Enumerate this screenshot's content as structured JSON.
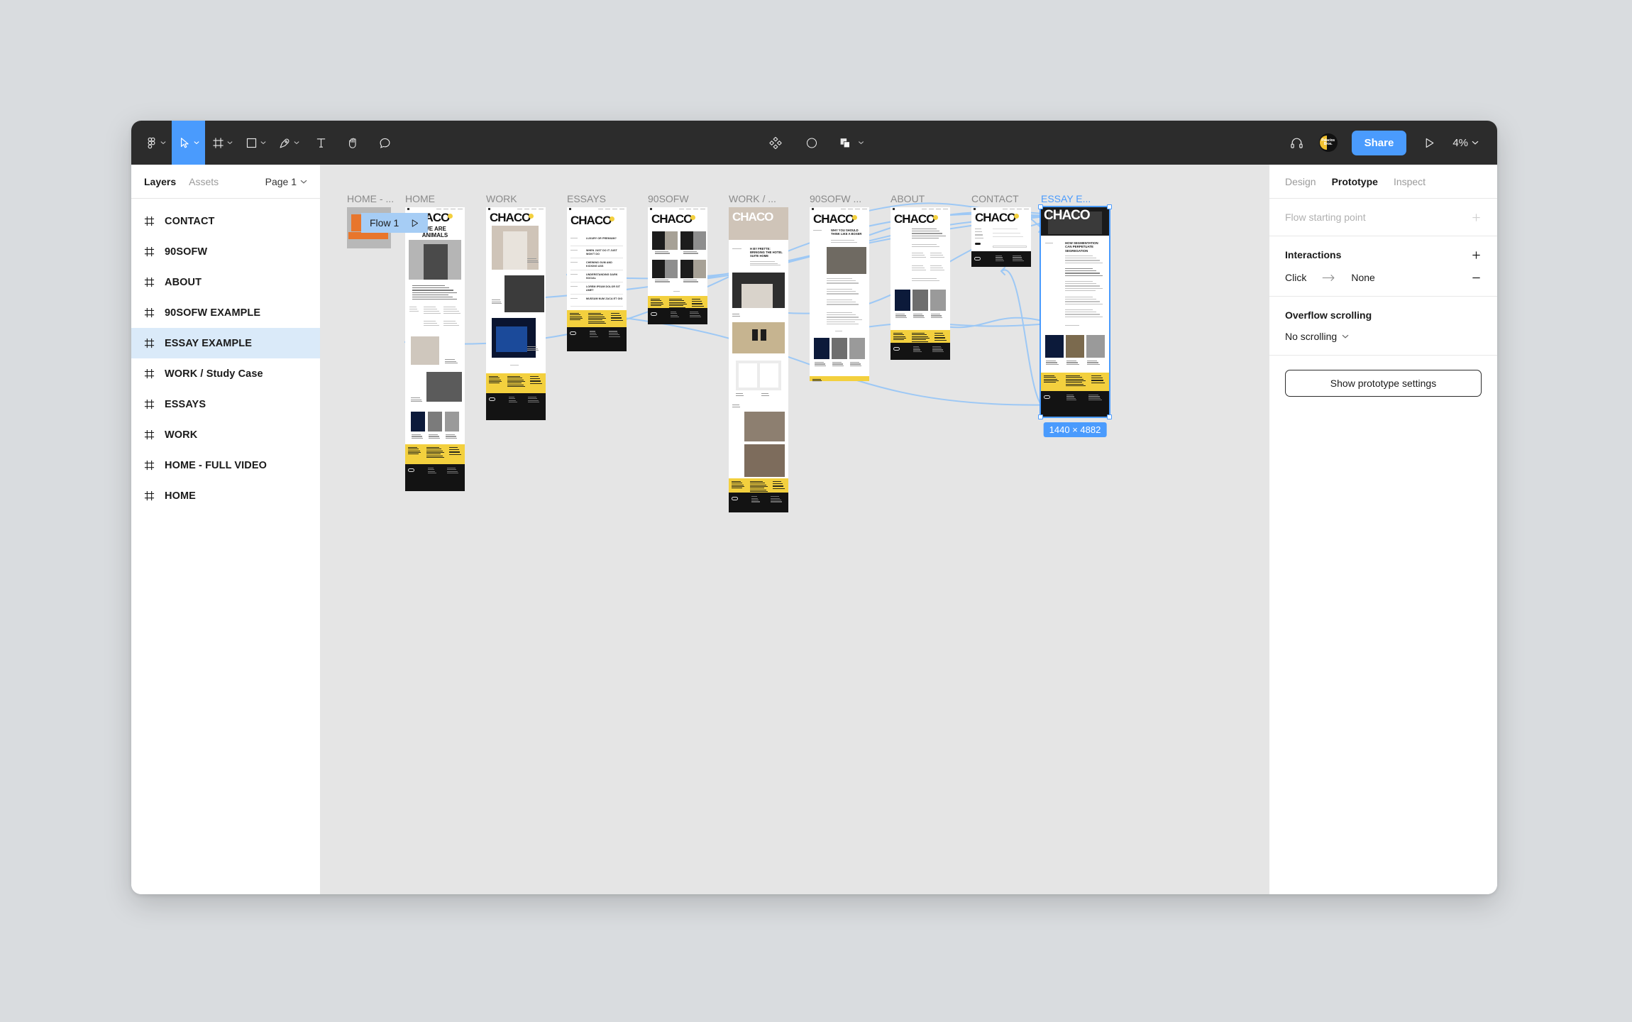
{
  "toolbar": {
    "menu_icon": "figma-logo-icon",
    "tools": [
      {
        "name": "move-tool",
        "icon": "cursor-icon",
        "active": true
      },
      {
        "name": "frame-tool",
        "icon": "frame-icon",
        "active": false
      },
      {
        "name": "shape-tool",
        "icon": "square-icon",
        "active": false
      },
      {
        "name": "pen-tool",
        "icon": "pen-icon",
        "active": false
      },
      {
        "name": "text-tool",
        "icon": "text-icon",
        "active": false
      },
      {
        "name": "hand-tool",
        "icon": "hand-icon",
        "active": false
      },
      {
        "name": "comment-tool",
        "icon": "comment-icon",
        "active": false
      }
    ],
    "center_tools": [
      {
        "name": "components-icon"
      },
      {
        "name": "contrast-icon"
      },
      {
        "name": "boolean-icon"
      }
    ],
    "headphones_icon": "headphones-icon",
    "avatar_text": "Palacios Bros.",
    "share_label": "Share",
    "present_icon": "play-icon",
    "zoom_level": "4%"
  },
  "left_panel": {
    "tabs": [
      {
        "label": "Layers",
        "active": true
      },
      {
        "label": "Assets",
        "active": false
      }
    ],
    "page_selector": "Page 1",
    "layers": [
      {
        "label": "CONTACT",
        "selected": false
      },
      {
        "label": "90SOFW",
        "selected": false
      },
      {
        "label": "ABOUT",
        "selected": false
      },
      {
        "label": "90SOFW EXAMPLE",
        "selected": false
      },
      {
        "label": "ESSAY EXAMPLE",
        "selected": true
      },
      {
        "label": "WORK / Study Case",
        "selected": false
      },
      {
        "label": "ESSAYS",
        "selected": false
      },
      {
        "label": "WORK",
        "selected": false
      },
      {
        "label": "HOME - FULL VIDEO",
        "selected": false
      },
      {
        "label": "HOME",
        "selected": false
      }
    ]
  },
  "canvas": {
    "flow_badge": {
      "label": "Flow 1",
      "icon": "play-icon"
    },
    "selection": {
      "dimensions": "1440 × 4882"
    },
    "frames": [
      {
        "label": "HOME - ...",
        "selected": false
      },
      {
        "label": "HOME",
        "selected": false
      },
      {
        "label": "WORK",
        "selected": false
      },
      {
        "label": "ESSAYS",
        "selected": false
      },
      {
        "label": "90SOFW",
        "selected": false
      },
      {
        "label": "WORK / ...",
        "selected": false
      },
      {
        "label": "90SOFW ...",
        "selected": false
      },
      {
        "label": "ABOUT",
        "selected": false
      },
      {
        "label": "CONTACT",
        "selected": false
      },
      {
        "label": "ESSAY E...",
        "selected": true
      }
    ],
    "brand_wordmark": "CHACO",
    "home_headline": "WE ARE ANIMALS",
    "home_body": "WE ARE A GLOBAL STRATEGY-FIRST COMMUNICATIONS CONSULTANCY THAT RELIES ON SCIENCE AND CREATIVITY TO SOLVE BUSINESS PROBLEMS FOR BRANDS, GOVERNMENTS AND THE AGENCIES THAT SERVE THEM.",
    "essay_items": [
      "LUXURY OR PREMIUM?",
      "WHEN JUST DO IT JUST WON'T DO",
      "CHEWING GUM AND KICKING ASS",
      "UNDERSTANDING DARK SOCIAL",
      "LOREM IPSUM DOLOR SIT AMET",
      "MUSSUM NUM ZACA ET OIO"
    ],
    "work_case_headline": "H BY FRETTE: BRINGING THE HOTEL SUITE HOME",
    "sofw_example_headline": "WHY YOU SHOULD THINK LIKE A BOXER",
    "essay_example_headline": "HOW SEGMENTATION CAN PERPETUATE SEGREGATION"
  },
  "right_panel": {
    "tabs": [
      {
        "label": "Design",
        "active": false
      },
      {
        "label": "Prototype",
        "active": true
      },
      {
        "label": "Inspect",
        "active": false
      }
    ],
    "flow_starting_point": {
      "label": "Flow starting point",
      "add_icon": "plus-icon"
    },
    "interactions": {
      "title": "Interactions",
      "add_icon": "plus-icon",
      "rows": [
        {
          "trigger": "Click",
          "arrow": "arrow-right-icon",
          "target": "None",
          "remove_icon": "minus-icon"
        }
      ]
    },
    "overflow_scrolling": {
      "title": "Overflow scrolling",
      "value": "No scrolling",
      "caret": "chevron-down-icon"
    },
    "show_prototype_settings": "Show prototype settings"
  },
  "colors": {
    "accent": "#4a9bfd",
    "toolbar_bg": "#2c2c2c",
    "canvas_bg": "#e5e5e5",
    "selection_fill": "#daeaf9",
    "brand_yellow": "#f3d03e"
  }
}
